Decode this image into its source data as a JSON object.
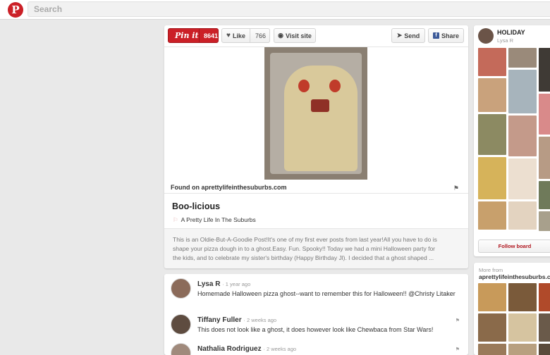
{
  "header": {
    "logo_glyph": "P",
    "search_placeholder": "Search"
  },
  "toolbar": {
    "pinit_label": "Pin it",
    "pin_count": "8641",
    "like_label": "Like",
    "like_count": "766",
    "visit_label": "Visit site",
    "send_label": "Send",
    "share_label": "Share"
  },
  "pin": {
    "found_on": "Found on aprettylifeinthesuburbs.com",
    "title": "Boo-licious",
    "board_name": "A Pretty Life In The Suburbs",
    "description": "This is an Oldie-But-A-Goodie Post!It's one of my first ever posts from last year!All you have to do is shape your pizza dough in to a ghost.Easy. Fun. Spooky!! Today we had a mini Halloween party for the kids, and to celebrate my sister's birthday (Happy Birthday Jl). I decided that a ghost shaped ..."
  },
  "comments": [
    {
      "name": "Lysa R",
      "ago": "1 year ago",
      "text": "Homemade Halloween pizza ghost--want to remember this for Halloween!! @Christy Litaker"
    },
    {
      "name": "Tiffany Fuller",
      "ago": "2 weeks ago",
      "text": "This does not look like a ghost, it does however look like Chewbaca from Star Wars!"
    },
    {
      "name": "Nathalia Rodriguez",
      "ago": "2 weeks ago",
      "text": ""
    }
  ],
  "sidebar": {
    "board_title": "HOLIDAY",
    "board_user": "Lysa R",
    "follow_label": "Follow board",
    "more_from_label": "More from",
    "more_from_source": "aprettylifeinthesuburbs.com"
  },
  "colors": {
    "brand_red": "#cb2027",
    "background": "#e9e9e9"
  }
}
